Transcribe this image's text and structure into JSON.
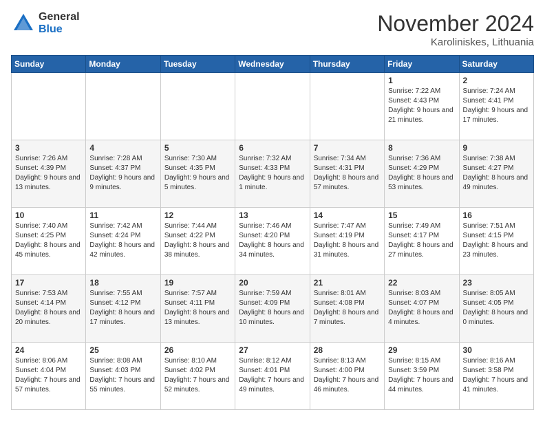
{
  "logo": {
    "general": "General",
    "blue": "Blue"
  },
  "header": {
    "month": "November 2024",
    "location": "Karoliniskes, Lithuania"
  },
  "days_of_week": [
    "Sunday",
    "Monday",
    "Tuesday",
    "Wednesday",
    "Thursday",
    "Friday",
    "Saturday"
  ],
  "weeks": [
    [
      {
        "day": "",
        "info": ""
      },
      {
        "day": "",
        "info": ""
      },
      {
        "day": "",
        "info": ""
      },
      {
        "day": "",
        "info": ""
      },
      {
        "day": "",
        "info": ""
      },
      {
        "day": "1",
        "info": "Sunrise: 7:22 AM\nSunset: 4:43 PM\nDaylight: 9 hours and 21 minutes."
      },
      {
        "day": "2",
        "info": "Sunrise: 7:24 AM\nSunset: 4:41 PM\nDaylight: 9 hours and 17 minutes."
      }
    ],
    [
      {
        "day": "3",
        "info": "Sunrise: 7:26 AM\nSunset: 4:39 PM\nDaylight: 9 hours and 13 minutes."
      },
      {
        "day": "4",
        "info": "Sunrise: 7:28 AM\nSunset: 4:37 PM\nDaylight: 9 hours and 9 minutes."
      },
      {
        "day": "5",
        "info": "Sunrise: 7:30 AM\nSunset: 4:35 PM\nDaylight: 9 hours and 5 minutes."
      },
      {
        "day": "6",
        "info": "Sunrise: 7:32 AM\nSunset: 4:33 PM\nDaylight: 9 hours and 1 minute."
      },
      {
        "day": "7",
        "info": "Sunrise: 7:34 AM\nSunset: 4:31 PM\nDaylight: 8 hours and 57 minutes."
      },
      {
        "day": "8",
        "info": "Sunrise: 7:36 AM\nSunset: 4:29 PM\nDaylight: 8 hours and 53 minutes."
      },
      {
        "day": "9",
        "info": "Sunrise: 7:38 AM\nSunset: 4:27 PM\nDaylight: 8 hours and 49 minutes."
      }
    ],
    [
      {
        "day": "10",
        "info": "Sunrise: 7:40 AM\nSunset: 4:25 PM\nDaylight: 8 hours and 45 minutes."
      },
      {
        "day": "11",
        "info": "Sunrise: 7:42 AM\nSunset: 4:24 PM\nDaylight: 8 hours and 42 minutes."
      },
      {
        "day": "12",
        "info": "Sunrise: 7:44 AM\nSunset: 4:22 PM\nDaylight: 8 hours and 38 minutes."
      },
      {
        "day": "13",
        "info": "Sunrise: 7:46 AM\nSunset: 4:20 PM\nDaylight: 8 hours and 34 minutes."
      },
      {
        "day": "14",
        "info": "Sunrise: 7:47 AM\nSunset: 4:19 PM\nDaylight: 8 hours and 31 minutes."
      },
      {
        "day": "15",
        "info": "Sunrise: 7:49 AM\nSunset: 4:17 PM\nDaylight: 8 hours and 27 minutes."
      },
      {
        "day": "16",
        "info": "Sunrise: 7:51 AM\nSunset: 4:15 PM\nDaylight: 8 hours and 23 minutes."
      }
    ],
    [
      {
        "day": "17",
        "info": "Sunrise: 7:53 AM\nSunset: 4:14 PM\nDaylight: 8 hours and 20 minutes."
      },
      {
        "day": "18",
        "info": "Sunrise: 7:55 AM\nSunset: 4:12 PM\nDaylight: 8 hours and 17 minutes."
      },
      {
        "day": "19",
        "info": "Sunrise: 7:57 AM\nSunset: 4:11 PM\nDaylight: 8 hours and 13 minutes."
      },
      {
        "day": "20",
        "info": "Sunrise: 7:59 AM\nSunset: 4:09 PM\nDaylight: 8 hours and 10 minutes."
      },
      {
        "day": "21",
        "info": "Sunrise: 8:01 AM\nSunset: 4:08 PM\nDaylight: 8 hours and 7 minutes."
      },
      {
        "day": "22",
        "info": "Sunrise: 8:03 AM\nSunset: 4:07 PM\nDaylight: 8 hours and 4 minutes."
      },
      {
        "day": "23",
        "info": "Sunrise: 8:05 AM\nSunset: 4:05 PM\nDaylight: 8 hours and 0 minutes."
      }
    ],
    [
      {
        "day": "24",
        "info": "Sunrise: 8:06 AM\nSunset: 4:04 PM\nDaylight: 7 hours and 57 minutes."
      },
      {
        "day": "25",
        "info": "Sunrise: 8:08 AM\nSunset: 4:03 PM\nDaylight: 7 hours and 55 minutes."
      },
      {
        "day": "26",
        "info": "Sunrise: 8:10 AM\nSunset: 4:02 PM\nDaylight: 7 hours and 52 minutes."
      },
      {
        "day": "27",
        "info": "Sunrise: 8:12 AM\nSunset: 4:01 PM\nDaylight: 7 hours and 49 minutes."
      },
      {
        "day": "28",
        "info": "Sunrise: 8:13 AM\nSunset: 4:00 PM\nDaylight: 7 hours and 46 minutes."
      },
      {
        "day": "29",
        "info": "Sunrise: 8:15 AM\nSunset: 3:59 PM\nDaylight: 7 hours and 44 minutes."
      },
      {
        "day": "30",
        "info": "Sunrise: 8:16 AM\nSunset: 3:58 PM\nDaylight: 7 hours and 41 minutes."
      }
    ]
  ]
}
